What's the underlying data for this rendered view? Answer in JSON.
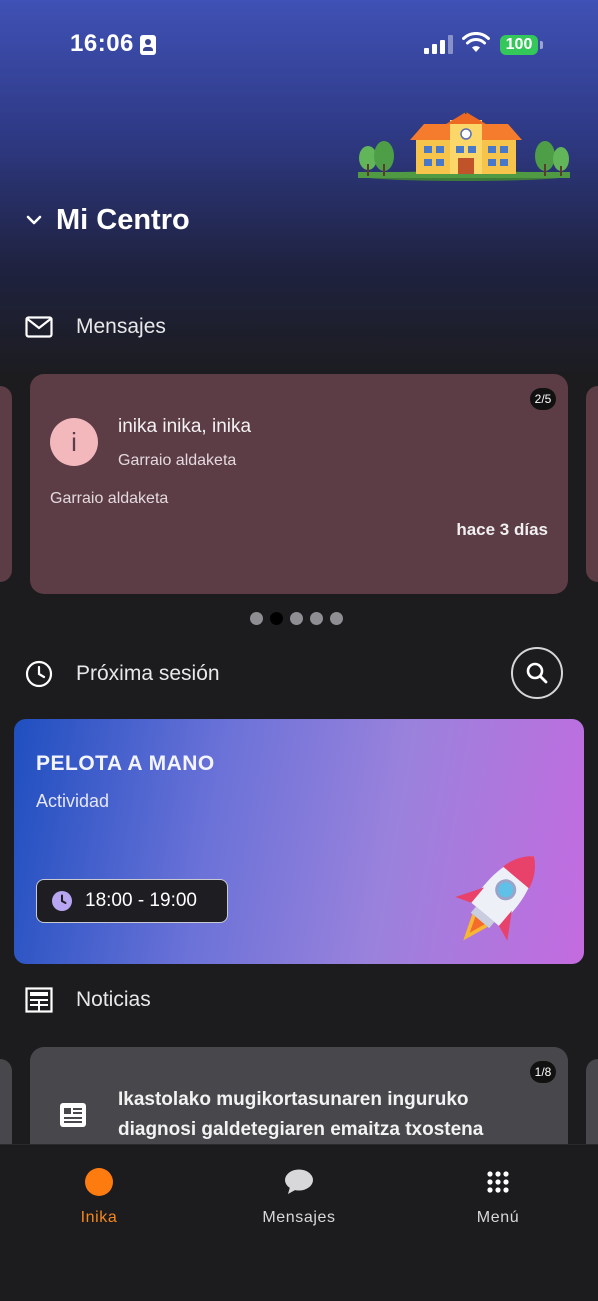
{
  "status_bar": {
    "time": "16:06",
    "battery": "100"
  },
  "header": {
    "title": "Mi Centro"
  },
  "messages_section": {
    "label": "Mensajes",
    "card": {
      "avatar_letter": "i",
      "sender": "inika inika, inika",
      "subject": "Garraio aldaketa",
      "body": "Garraio aldaketa",
      "time": "hace 3 días",
      "page_indicator": "2/5"
    },
    "pagination": {
      "count": 5,
      "active_index": 1
    }
  },
  "session_section": {
    "label": "Próxima sesión",
    "card": {
      "title": "PELOTA A MANO",
      "type": "Actividad",
      "time_range": "18:00 - 19:00"
    }
  },
  "news_section": {
    "label": "Noticias",
    "card": {
      "title": "Ikastolako mugikortasunaren inguruko diagnosi galdetegiaren emaitza txostena",
      "page_indicator": "1/8"
    }
  },
  "tab_bar": {
    "tabs": [
      {
        "label": "Inika",
        "icon": "orange-dot-icon",
        "active": true
      },
      {
        "label": "Mensajes",
        "icon": "chat-bubble-icon",
        "active": false
      },
      {
        "label": "Menú",
        "icon": "grid-icon",
        "active": false
      }
    ]
  },
  "colors": {
    "accent": "#FE7C0F",
    "message_card": "#5C3C45",
    "news_card": "#48484C",
    "battery": "#34C759"
  }
}
